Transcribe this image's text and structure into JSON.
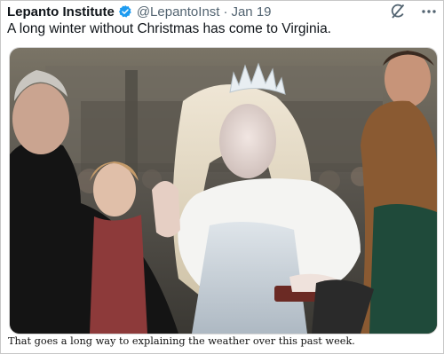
{
  "tweet": {
    "author_name": "Lepanto Institute",
    "handle": "@LepantoInst",
    "separator": "·",
    "date": "Jan 19",
    "text": "A long winter without Christmas has come to Virginia.",
    "verified_color": "#1d9bf0"
  },
  "icons": {
    "verified": "verified-badge-icon",
    "grok": "grok-icon",
    "more": "more-options-icon"
  },
  "media": {
    "description_icon": "inaugural-oath-photo"
  },
  "caption": "That goes a long way to explaining the weather over this past week."
}
